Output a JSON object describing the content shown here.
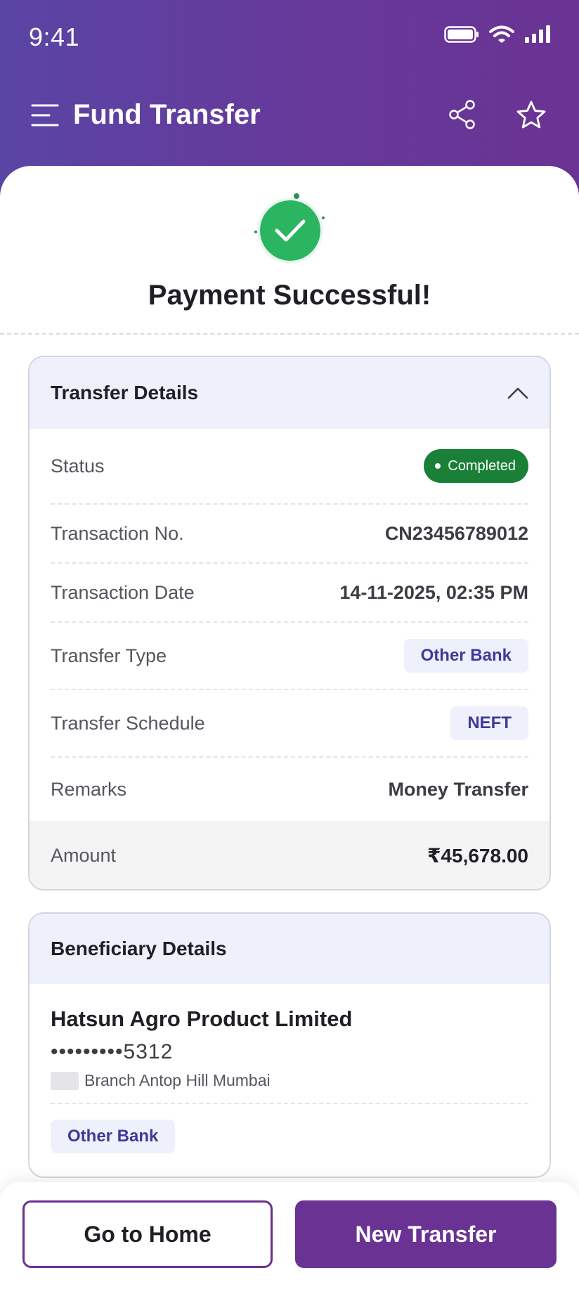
{
  "status_bar": {
    "time": "9:41"
  },
  "app_bar": {
    "title": "Fund Transfer"
  },
  "success": {
    "title": "Payment Successful!"
  },
  "transfer_details": {
    "title": "Transfer Details",
    "status_label": "Status",
    "status_value": "Completed",
    "rows": [
      {
        "label": "Transaction No.",
        "value": "CN23456789012"
      },
      {
        "label": "Transaction Date",
        "value": "14-11-2025, 02:35 PM"
      }
    ],
    "transfer_type_label": "Transfer Type",
    "transfer_type_value": "Other Bank",
    "transfer_schedule_label": "Transfer Schedule",
    "transfer_schedule_value": "NEFT",
    "remarks_label": "Remarks",
    "remarks_value": "Money Transfer",
    "amount_label": "Amount",
    "amount_value": "₹45,678.00"
  },
  "beneficiary": {
    "title": "Beneficiary Details",
    "name": "Hatsun Agro Product Limited",
    "account": "•••••••••5312",
    "branch": "Branch Antop Hill Mumbai",
    "bank_type": "Other Bank"
  },
  "footer": {
    "home_label": "Go to Home",
    "new_transfer_label": "New Transfer"
  },
  "colors": {
    "header_gradient_start": "#5a45a5",
    "header_gradient_end": "#6a3393",
    "success_green": "#2bb561",
    "completed_badge": "#1a7f37",
    "primary_purple": "#6a3393"
  },
  "icons": [
    "menu-icon",
    "share-icon",
    "star-icon",
    "battery-icon",
    "wifi-icon",
    "signal-icon",
    "check-icon",
    "chevron-up-icon"
  ]
}
